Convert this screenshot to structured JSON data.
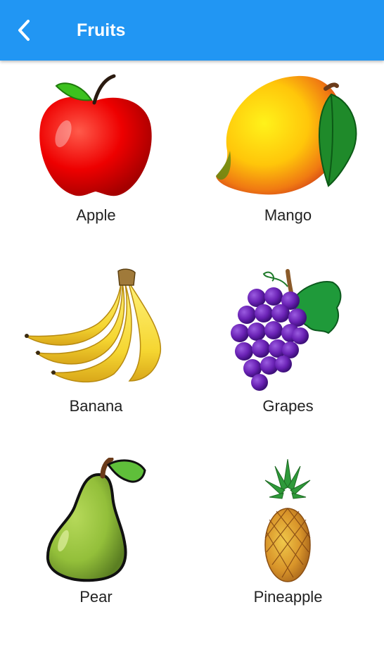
{
  "app_bar": {
    "title": "Fruits",
    "back_icon": "chevron-left-icon",
    "color": "#2196F3"
  },
  "fruits": [
    {
      "label": "Apple",
      "icon": "apple-icon"
    },
    {
      "label": "Mango",
      "icon": "mango-icon"
    },
    {
      "label": "Banana",
      "icon": "banana-icon"
    },
    {
      "label": "Grapes",
      "icon": "grapes-icon"
    },
    {
      "label": "Pear",
      "icon": "pear-icon"
    },
    {
      "label": "Pineapple",
      "icon": "pineapple-icon"
    }
  ]
}
